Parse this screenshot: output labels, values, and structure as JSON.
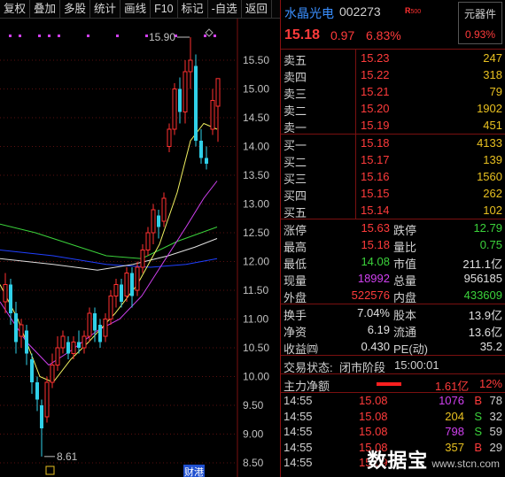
{
  "toolbar": [
    "复权",
    "叠加",
    "多股",
    "统计",
    "画线",
    "F10",
    "标记",
    "-自选",
    "返回"
  ],
  "stock": {
    "name": "水晶光电",
    "code": "002273",
    "badge": "R",
    "badge_sub": "500",
    "price": "15.18",
    "change": "0.97",
    "pct": "6.83%",
    "sector_name": "元器件",
    "sector_pct": "0.93%"
  },
  "order_book": {
    "sell": [
      {
        "label": "卖五",
        "price": "15.23",
        "vol": "247"
      },
      {
        "label": "卖四",
        "price": "15.22",
        "vol": "318"
      },
      {
        "label": "卖三",
        "price": "15.21",
        "vol": "79"
      },
      {
        "label": "卖二",
        "price": "15.20",
        "vol": "1902"
      },
      {
        "label": "卖一",
        "price": "15.19",
        "vol": "451"
      }
    ],
    "buy": [
      {
        "label": "买一",
        "price": "15.18",
        "vol": "4133"
      },
      {
        "label": "买二",
        "price": "15.17",
        "vol": "139"
      },
      {
        "label": "买三",
        "price": "15.16",
        "vol": "1560"
      },
      {
        "label": "买四",
        "price": "15.15",
        "vol": "262"
      },
      {
        "label": "买五",
        "price": "15.14",
        "vol": "102"
      }
    ]
  },
  "stats_a": [
    {
      "k1": "涨停",
      "v1": "15.63",
      "c1": "red",
      "k2": "跌停",
      "v2": "12.79",
      "c2": "green"
    },
    {
      "k1": "最高",
      "v1": "15.18",
      "c1": "red",
      "k2": "量比",
      "v2": "0.75",
      "c2": "green"
    },
    {
      "k1": "最低",
      "v1": "14.08",
      "c1": "green",
      "k2": "市值",
      "v2": "211.1亿",
      "c2": "white"
    },
    {
      "k1": "现量",
      "v1": "18992",
      "c1": "purple",
      "k2": "总量",
      "v2": "956185",
      "c2": "white"
    },
    {
      "k1": "外盘",
      "v1": "522576",
      "c1": "red",
      "k2": "内盘",
      "v2": "433609",
      "c2": "green"
    }
  ],
  "stats_b": [
    {
      "k1": "换手",
      "v1": "7.04%",
      "c1": "white",
      "k2": "股本",
      "v2": "13.9亿",
      "c2": "white"
    },
    {
      "k1": "净资",
      "v1": "6.19",
      "c1": "white",
      "k2": "流通",
      "v2": "13.6亿",
      "c2": "white"
    },
    {
      "k1": "收益㈣",
      "v1": "0.430",
      "c1": "white",
      "k2": "PE(动)",
      "v2": "35.2",
      "c2": "white"
    }
  ],
  "trade_state": {
    "label": "交易状态:",
    "value": "闭市阶段",
    "time": "15:00:01"
  },
  "main_flow": {
    "label": "主力净额",
    "value": "1.61亿",
    "pct": "12%"
  },
  "ticks": [
    {
      "time": "14:55",
      "price": "15.08",
      "vol": "1076",
      "side": "B",
      "num": "78",
      "vcolor": "purple",
      "scolor": "red"
    },
    {
      "time": "14:55",
      "price": "15.08",
      "vol": "204",
      "side": "S",
      "num": "32",
      "vcolor": "yellow",
      "scolor": "green"
    },
    {
      "time": "14:55",
      "price": "15.08",
      "vol": "798",
      "side": "S",
      "num": "59",
      "vcolor": "purple",
      "scolor": "green"
    },
    {
      "time": "14:55",
      "price": "15.08",
      "vol": "357",
      "side": "B",
      "num": "29",
      "vcolor": "yellow",
      "scolor": "red"
    },
    {
      "time": "14:55",
      "price": "15.09",
      "vol": "",
      "side": "",
      "num": "",
      "vcolor": "yellow",
      "scolor": "red"
    }
  ],
  "chart": {
    "y_labels": [
      "15.50",
      "15.00",
      "14.50",
      "14.00",
      "13.50",
      "13.00",
      "12.50",
      "12.00",
      "11.50",
      "11.00",
      "10.50",
      "10.00",
      "9.50",
      "9.00",
      "8.50"
    ],
    "high_label": "15.90",
    "low_label": "8.61",
    "bottom_tag": "财",
    "bottom_tag2": "港"
  },
  "watermark": {
    "main": "数据宝",
    "sub": "www.stcn.com"
  }
}
